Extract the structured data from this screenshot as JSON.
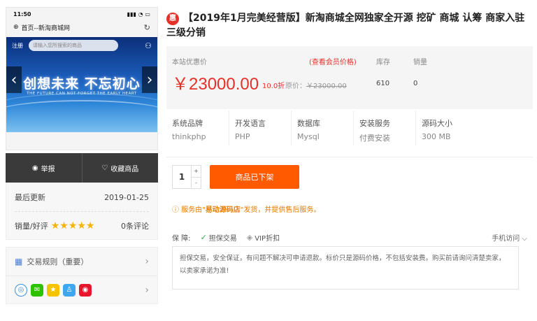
{
  "phone": {
    "time": "11:50",
    "status_icons": "▮▮▮ ◔ ▭",
    "page_title": "首页--新淘商城网",
    "banner": {
      "register": "注册",
      "search_placeholder": "请输入您所搜索的商品",
      "headline": "创想未来  不忘初心",
      "subline": "THE FUTURE CAN NOT FORGET THE EARLY HEART"
    }
  },
  "actions": {
    "report_label": "举报",
    "favorite_label": "收藏商品"
  },
  "info": {
    "last_update_label": "最后更新",
    "last_update_value": "2019-01-25",
    "sales_label": "销量/好评",
    "rating_stars": 5,
    "reviews": "0条评论"
  },
  "rules": {
    "label": "交易规则（重要）"
  },
  "product": {
    "badge": "惠",
    "title": "【2019年1月完美经营版】新淘商城全网独家全开源 挖矿 商城 认筹 商家入驻 三级分销",
    "price_label": "本站优惠价",
    "vip_link": "(查看会员价格)",
    "price": "￥23000.00",
    "discount": "10.0折",
    "orig_label": "原价：",
    "orig_price": "￥23000.00",
    "stock_label": "库存",
    "stock_value": "610",
    "sales_label": "销量",
    "sales_value": "0",
    "specs": [
      {
        "key": "系统品牌",
        "value": "thinkphp"
      },
      {
        "key": "开发语言",
        "value": "PHP"
      },
      {
        "key": "数据库",
        "value": "Mysql"
      },
      {
        "key": "安装服务",
        "value": "付费安装"
      },
      {
        "key": "源码大小",
        "value": "300 MB"
      }
    ],
    "quantity": "1",
    "buy_label": "商品已下架",
    "service_prefix": "服务由\"",
    "service_store": "易动源码店",
    "service_suffix": "\"发货，并提供售后服务。",
    "guard_label": "保 障:",
    "guard_tag1": "担保交易",
    "guard_tag2": "VIP折扣",
    "mobile_label": "手机访问",
    "note": "担保交易，安全保证，有问题不解决可申请退款。标价只是源码价格，不包括安装费。购买前请询问清楚卖家，以卖家承诺为准!"
  },
  "colors": {
    "accent_red": "#e5312a",
    "buy_orange": "#ff5a00",
    "star_gold": "#f5b400",
    "dark_bar": "#3a3a3a"
  }
}
